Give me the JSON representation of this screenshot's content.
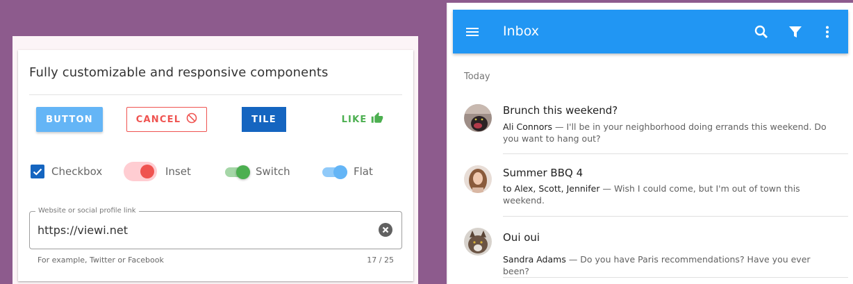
{
  "left_card": {
    "title": "Fully customizable and responsive components",
    "buttons": {
      "primary": "BUTTON",
      "cancel": "CANCEL",
      "tile": "TILE",
      "like": "LIKE"
    },
    "controls": {
      "checkbox_label": "Checkbox",
      "checkbox_checked": true,
      "inset_label": "Inset",
      "switch_label": "Switch",
      "flat_label": "Flat"
    },
    "field": {
      "legend": "Website or social profile link",
      "value": "https://viewi.net",
      "hint": "For example, Twitter or Facebook",
      "counter": "17 / 25"
    }
  },
  "inbox": {
    "title": "Inbox",
    "icons": [
      "menu-icon",
      "search-icon",
      "filter-icon",
      "more-vert-icon"
    ],
    "subheader": "Today",
    "messages": [
      {
        "title": "Brunch this weekend?",
        "from": "Ali Connors",
        "preview": " — I'll be in your neighborhood doing errands this weekend. Do you want to hang out?"
      },
      {
        "title": "Summer BBQ 4",
        "from": "to Alex, Scott, Jennifer",
        "preview": " — Wish I could come, but I'm out of town this weekend."
      },
      {
        "title": "Oui oui",
        "from": "Sandra Adams",
        "preview": " — Do you have Paris recommendations? Have you ever been?"
      }
    ]
  },
  "colors": {
    "background": "#8d5b8d",
    "primary": "#2196f3",
    "light_blue": "#64b5f6",
    "dark_blue": "#1565c0",
    "error": "#ef5350",
    "success": "#4caf50"
  }
}
